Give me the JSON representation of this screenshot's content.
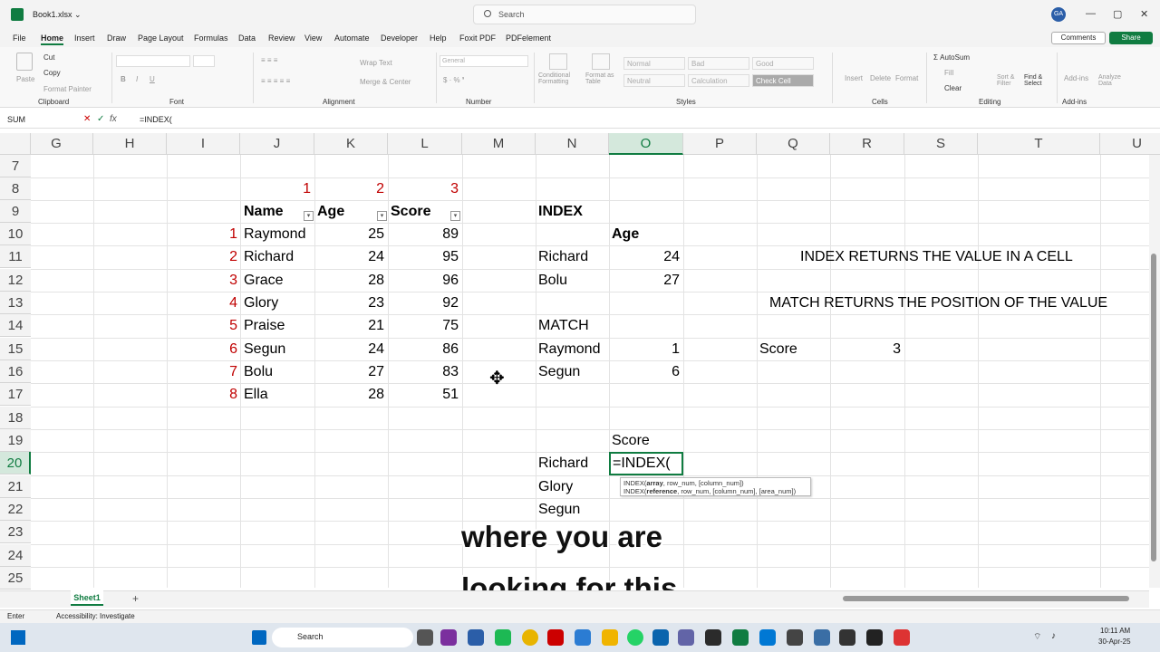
{
  "title_bar": {
    "file_name": "Book1.xlsx ⌄",
    "search": "Search",
    "avatar": "GA"
  },
  "menu": [
    "File",
    "Home",
    "Insert",
    "Draw",
    "Page Layout",
    "Formulas",
    "Data",
    "Review",
    "View",
    "Automate",
    "Developer",
    "Help",
    "Foxit PDF",
    "PDFelement"
  ],
  "comments_label": "Comments",
  "share_label": "Share",
  "ribbon": {
    "clipboard": {
      "paste": "Paste",
      "cut": "Cut",
      "copy": "Copy",
      "format_painter": "Format Painter",
      "group": "Clipboard"
    },
    "font": {
      "group": "Font"
    },
    "alignment": {
      "wrap": "Wrap Text",
      "merge": "Merge & Center",
      "group": "Alignment"
    },
    "number": {
      "format": "General",
      "group": "Number"
    },
    "styles": {
      "cf": "Conditional Formatting",
      "fat": "Format as Table",
      "normal": "Normal",
      "bad": "Bad",
      "good": "Good",
      "neutral": "Neutral",
      "calculation": "Calculation",
      "check": "Check Cell",
      "group": "Styles"
    },
    "cells": {
      "insert": "Insert",
      "delete": "Delete",
      "format": "Format",
      "group": "Cells"
    },
    "editing": {
      "autosum": "AutoSum",
      "fill": "Fill",
      "clear": "Clear",
      "sort": "Sort & Filter",
      "find": "Find & Select",
      "group": "Editing"
    },
    "addins": {
      "addins": "Add-ins",
      "analyze": "Analyze Data",
      "group": "Add-ins"
    }
  },
  "formula_bar": {
    "name_box": "SUM",
    "formula": "=INDEX("
  },
  "columns": [
    "G",
    "H",
    "I",
    "J",
    "K",
    "L",
    "M",
    "N",
    "O",
    "P",
    "Q",
    "R",
    "S",
    "T",
    "U"
  ],
  "rows": [
    "7",
    "8",
    "9",
    "10",
    "11",
    "12",
    "13",
    "14",
    "15",
    "16",
    "17",
    "18",
    "19",
    "20",
    "21",
    "22",
    "23",
    "24",
    "25"
  ],
  "table": {
    "col_numbers": [
      "1",
      "2",
      "3"
    ],
    "headers": [
      "Name",
      "Age",
      "Score"
    ],
    "rows": [
      {
        "n": "1",
        "name": "Raymond",
        "age": "25",
        "score": "89"
      },
      {
        "n": "2",
        "name": "Richard",
        "age": "24",
        "score": "95"
      },
      {
        "n": "3",
        "name": "Grace",
        "age": "28",
        "score": "96"
      },
      {
        "n": "4",
        "name": "Glory",
        "age": "23",
        "score": "92"
      },
      {
        "n": "5",
        "name": "Praise",
        "age": "21",
        "score": "75"
      },
      {
        "n": "6",
        "name": "Segun",
        "age": "24",
        "score": "86"
      },
      {
        "n": "7",
        "name": "Bolu",
        "age": "27",
        "score": "83"
      },
      {
        "n": "8",
        "name": "Ella",
        "age": "28",
        "score": "51"
      }
    ]
  },
  "index_block": {
    "title": "INDEX",
    "age_hdr": "Age",
    "r1_name": "Richard",
    "r1_val": "24",
    "r2_name": "Bolu",
    "r2_val": "27"
  },
  "match_block": {
    "title": "MATCH",
    "r1_name": "Raymond",
    "r1_val": "1",
    "r2_name": "Segun",
    "r2_val": "6"
  },
  "notes": {
    "index_note": "INDEX RETURNS THE VALUE IN A CELL",
    "match_note": "MATCH RETURNS THE POSITION OF THE VALUE",
    "score_label": "Score",
    "score_val": "3"
  },
  "lookup": {
    "score_hdr": "Score",
    "names": [
      "Richard",
      "Glory",
      "Segun"
    ],
    "edit": "=INDEX("
  },
  "tooltip": {
    "line1_a": "INDEX(",
    "line1_b": "array",
    "line1_c": ", row_num, [column_num])",
    "line2_a": "INDEX(",
    "line2_b": "reference",
    "line2_c": ", row_num, [column_num], [area_num])"
  },
  "subtitle": {
    "line1": "where you are",
    "line2": "looking for this"
  },
  "sheet_tab": "Sheet1",
  "status": {
    "mode": "Enter",
    "accessibility": "Accessibility: Investigate"
  },
  "taskbar": {
    "search": "Search",
    "time": "10:11 AM",
    "date": "30-Apr-25"
  }
}
